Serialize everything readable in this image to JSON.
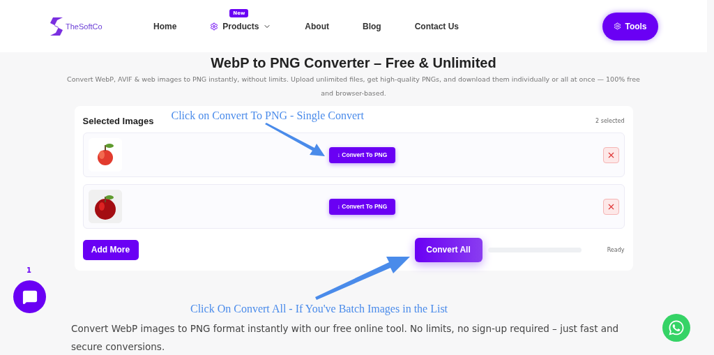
{
  "header": {
    "logo": "TheSoftCo",
    "nav": [
      {
        "kind": "link",
        "label": "Home"
      },
      {
        "kind": "menu",
        "label": "Products",
        "badge": "New"
      },
      {
        "kind": "link",
        "label": "About"
      },
      {
        "kind": "link",
        "label": "Blog"
      },
      {
        "kind": "link",
        "label": "Contact Us"
      }
    ],
    "tools_button": "Tools"
  },
  "title": "WebP to PNG Converter – Free & Unlimited",
  "subtitle": "Convert WebP, AVIF & web images to PNG instantly, without limits. Upload unlimited files, get high-quality PNGs, and download them individually or all at once — 100% free and browser-based.",
  "card": {
    "title": "Selected Images",
    "count": "2 selected",
    "images": [
      {
        "kind": "picture",
        "convert": "↓ Convert To PNG"
      },
      {
        "kind": "picture",
        "convert": "↓ Convert To PNG"
      }
    ],
    "add_more": "Add More",
    "convert_all": "Convert All",
    "status": "Ready"
  },
  "annotations": [
    "Click on Convert To PNG - Single Convert",
    "Click On Convert All - If You've Batch Images in the List"
  ],
  "body_text": "Convert WebP images to PNG format instantly with our free online tool. No limits, no sign-up required – just fast and secure conversions.",
  "chat": {
    "badge": "1"
  }
}
